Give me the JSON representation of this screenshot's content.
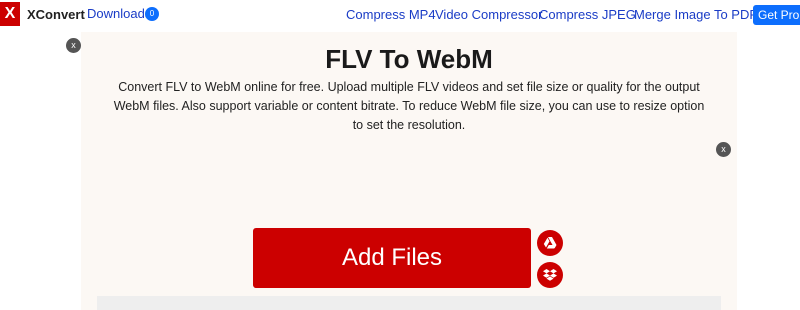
{
  "navbar": {
    "logo_letter": "X",
    "brand": "XConvert",
    "downloads_label": "Downloads",
    "downloads_count": "0",
    "links": [
      "Compress MP4",
      "Video Compressor",
      "Compress JPEG",
      "Merge Image To PDF"
    ],
    "get_pro": "Get Pro!"
  },
  "main": {
    "close_symbol": "x",
    "title": "FLV To WebM",
    "description": "Convert FLV to WebM online for free. Upload multiple FLV videos and set file size or quality for the output WebM files. Also support variable or content bitrate. To reduce WebM file size, you can use to resize option to set the resolution.",
    "add_files_label": "Add Files",
    "upload_sources": [
      "google-drive-icon",
      "dropbox-icon"
    ]
  },
  "colors": {
    "brand_red": "#cc0000",
    "link_blue": "#1a3cc6",
    "button_blue": "#0d6efd",
    "panel_bg": "#fcf8f4"
  }
}
